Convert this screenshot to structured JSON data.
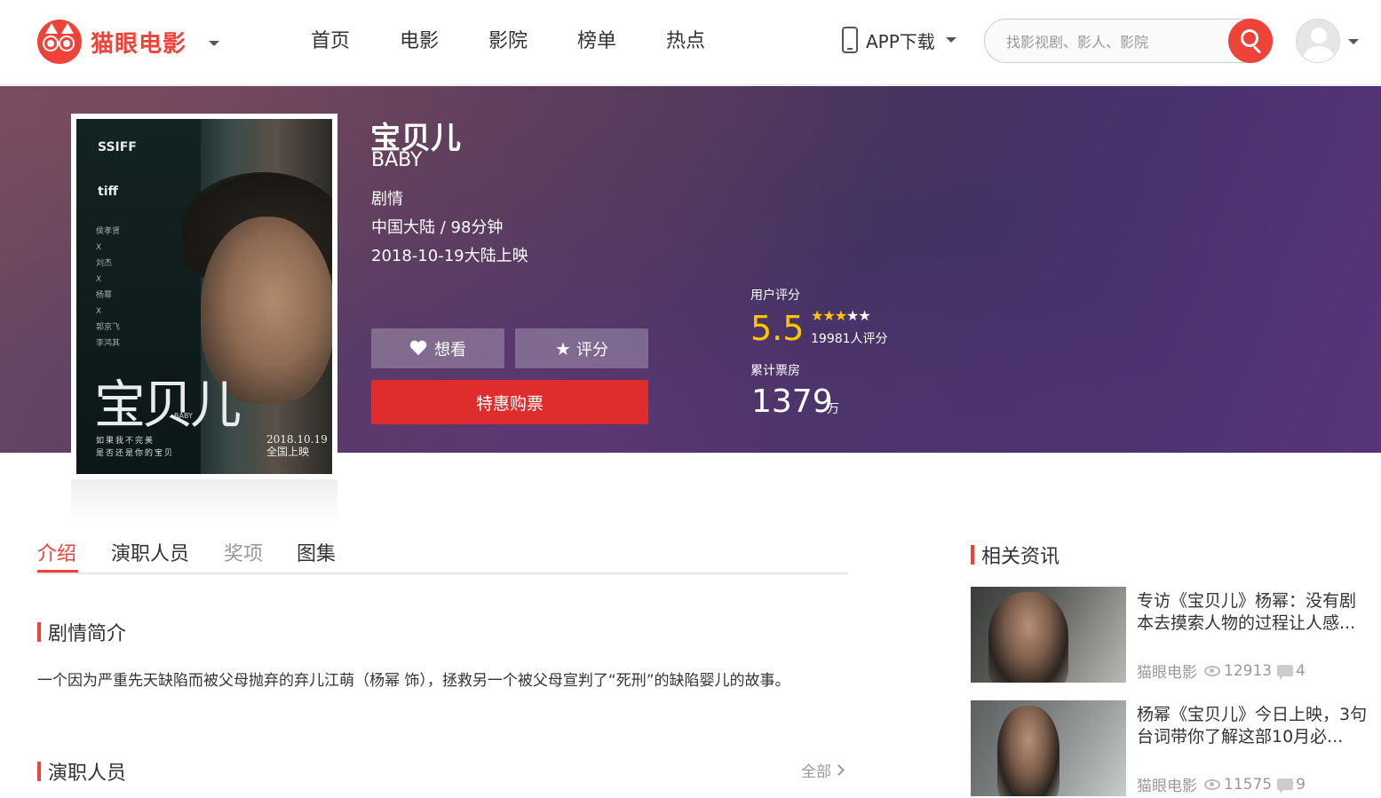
{
  "header": {
    "logo_text": "猫眼电影",
    "nav": [
      "首页",
      "电影",
      "影院",
      "榜单",
      "热点"
    ],
    "app_download": "APP下载",
    "search_placeholder": "找影视剧、影人、影院"
  },
  "movie": {
    "title": "宝贝儿",
    "title_en": "BABY",
    "genre": "剧情",
    "region_duration": "中国大陆 / 98分钟",
    "release": "2018-10-19大陆上映",
    "want_label": "想看",
    "rate_label": "评分",
    "buy_label": "特惠购票",
    "score_label": "用户评分",
    "score": "5.5",
    "score_stars": 2.75,
    "score_count": "19981人评分",
    "box_office_label": "累计票房",
    "box_office": "1379",
    "box_office_unit": "万"
  },
  "poster": {
    "festival_1": "SSIFF",
    "festival_2": "tiff",
    "credits": [
      "侯孝贤",
      "X",
      "刘杰",
      "X",
      "杨幂",
      "X",
      "郭京飞",
      "李鸿其"
    ],
    "title": "宝贝儿",
    "tag": "BABY",
    "tagline_1": "如果我不完美",
    "tagline_2": "是否还是你的宝贝",
    "date_1": "2018.10.19",
    "date_2": "全国上映"
  },
  "tabs": [
    {
      "label": "介绍",
      "state": "active"
    },
    {
      "label": "演职人员",
      "state": "normal"
    },
    {
      "label": "奖项",
      "state": "disabled"
    },
    {
      "label": "图集",
      "state": "normal"
    }
  ],
  "synopsis": {
    "heading": "剧情简介",
    "text": "一个因为严重先天缺陷而被父母抛弃的弃儿江萌（杨幂 饰），拯救另一个被父母宣判了“死刑”的缺陷婴儿的故事。"
  },
  "cast": {
    "heading": "演职人员",
    "all_label": "全部"
  },
  "news": {
    "heading": "相关资讯",
    "items": [
      {
        "title": "专访《宝贝儿》杨幂：没有剧本去摸索人物的过程让人感...",
        "source": "猫眼电影",
        "views": "12913",
        "comments": "4"
      },
      {
        "title": "杨幂《宝贝儿》今日上映，3句台词带你了解这部10月必...",
        "source": "猫眼电影",
        "views": "11575",
        "comments": "9"
      }
    ]
  },
  "colors": {
    "brand": "#ef4238",
    "buy_button": "#df2d2d",
    "score": "#ffc600"
  }
}
